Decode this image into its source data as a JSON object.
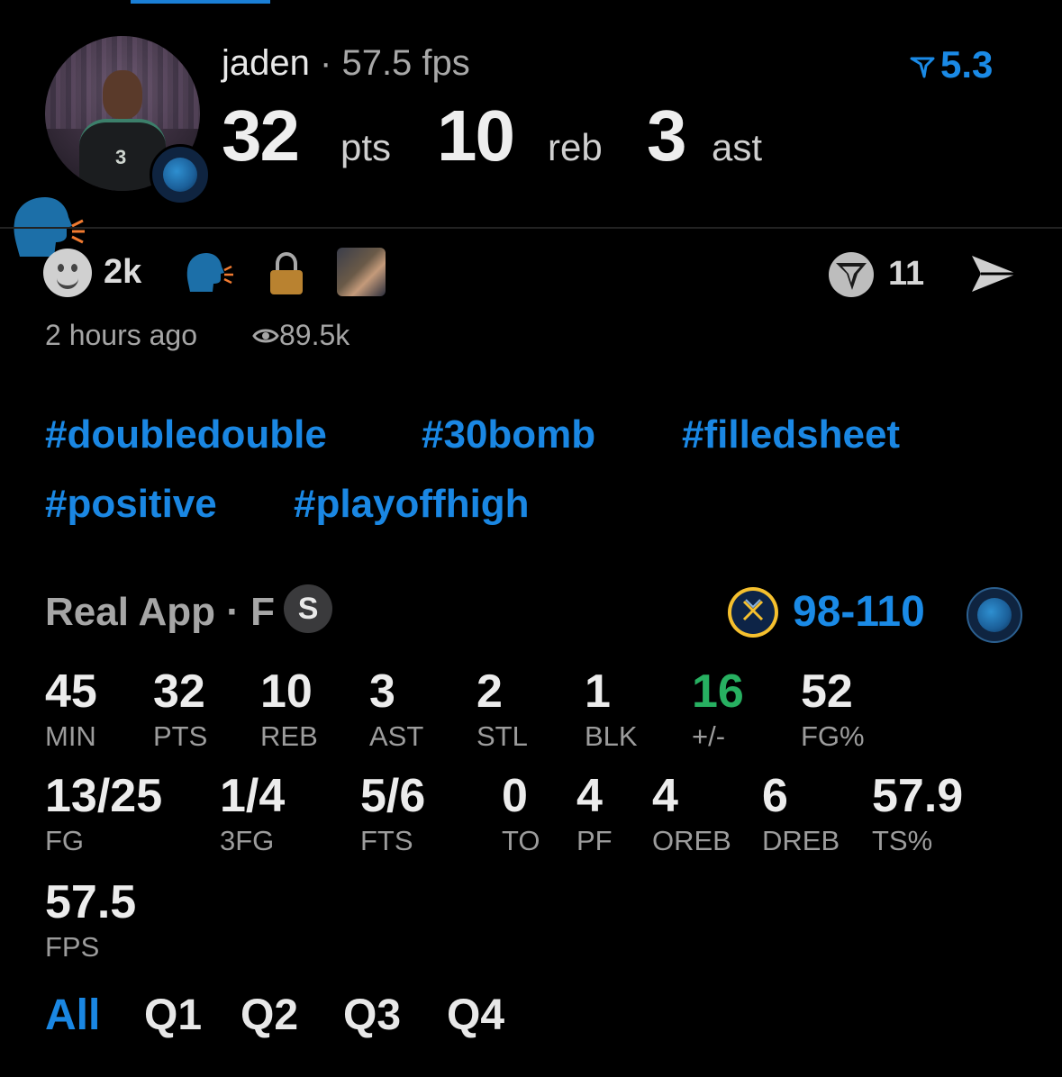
{
  "header": {
    "username": "jaden",
    "separator": "·",
    "fps_text": "57.5 fps",
    "rating": "5.3",
    "points": "32",
    "points_unit": "pts",
    "rebounds": "10",
    "rebounds_unit": "reb",
    "assists": "3",
    "assists_unit": "ast",
    "avatar_jersey_number": "3"
  },
  "actions": {
    "reaction_count": "2k",
    "share_count": "11",
    "icons": [
      "smiley-icon",
      "speaker-icon",
      "lock-icon",
      "friends-thumbnail",
      "v-shield-icon",
      "send-icon"
    ]
  },
  "meta": {
    "time_ago": "2 hours ago",
    "views": "89.5k"
  },
  "tags": [
    "#doubledouble",
    "#30bomb",
    "#filledsheet",
    "#positive",
    "#playoffhigh"
  ],
  "game": {
    "source": "Real App · F",
    "badge": "S",
    "score": "98-110"
  },
  "box_score": {
    "row1": [
      {
        "value": "45",
        "label": "MIN"
      },
      {
        "value": "32",
        "label": "PTS"
      },
      {
        "value": "10",
        "label": "REB"
      },
      {
        "value": "3",
        "label": "AST"
      },
      {
        "value": "2",
        "label": "STL"
      },
      {
        "value": "1",
        "label": "BLK"
      },
      {
        "value": "16",
        "label": "+/-"
      },
      {
        "value": "52",
        "label": "FG%"
      }
    ],
    "row2": [
      {
        "value": "13/25",
        "label": "FG"
      },
      {
        "value": "1/4",
        "label": "3FG"
      },
      {
        "value": "5/6",
        "label": "FTS"
      },
      {
        "value": "0",
        "label": "TO"
      },
      {
        "value": "4",
        "label": "PF"
      },
      {
        "value": "4",
        "label": "OREB"
      },
      {
        "value": "6",
        "label": "DREB"
      },
      {
        "value": "57.9",
        "label": "TS%"
      }
    ],
    "row3": [
      {
        "value": "57.5",
        "label": "FPS"
      }
    ]
  },
  "quarter_tabs": [
    "All",
    "Q1",
    "Q2",
    "Q3",
    "Q4"
  ],
  "colors": {
    "accent_blue": "#1a87e3",
    "positive_green": "#27b061",
    "background": "#000000"
  }
}
